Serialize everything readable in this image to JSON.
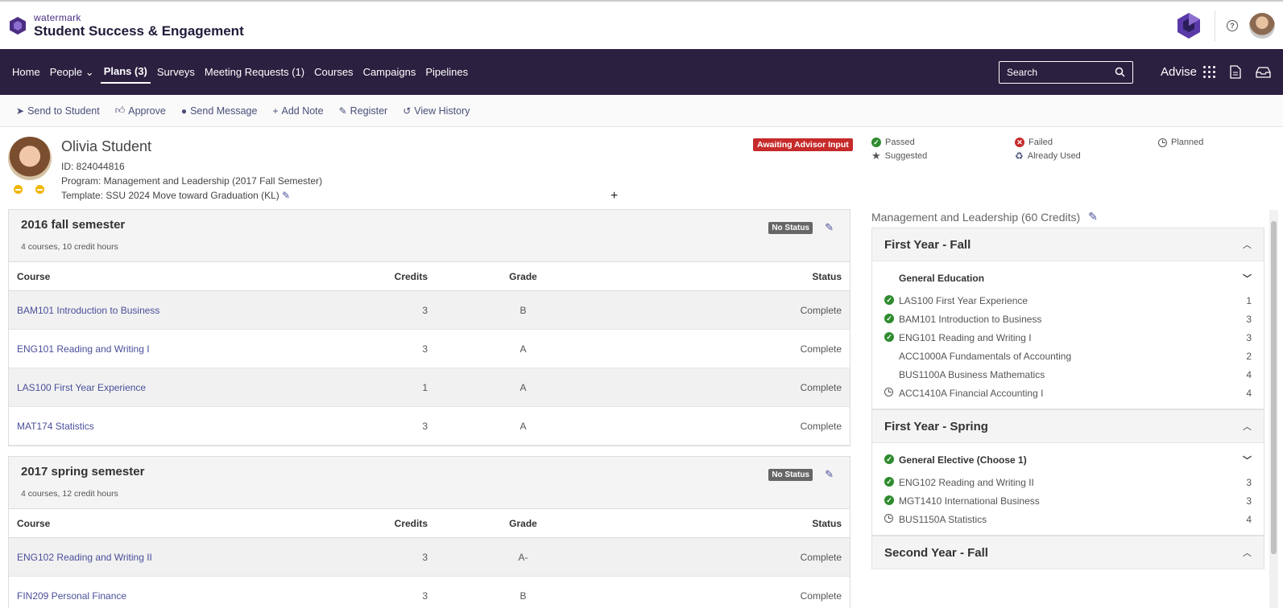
{
  "brand": {
    "small": "watermark",
    "title": "Student Success & Engagement"
  },
  "nav": {
    "items": [
      "Home",
      "People",
      "Plans (3)",
      "Surveys",
      "Meeting Requests (1)",
      "Courses",
      "Campaigns",
      "Pipelines"
    ],
    "search_label": "Search",
    "advise_label": "Advise"
  },
  "actions": [
    "Send to Student",
    "Approve",
    "Send Message",
    "Add Note",
    "Register",
    "View History"
  ],
  "student": {
    "name": "Olivia Student",
    "id_line": "ID: 824044816",
    "program_line": "Program: Management and Leadership (2017 Fall Semester)",
    "template_line": "Template: SSU 2024 Move toward Graduation (KL)",
    "plan_status": "Awaiting Advisor Input"
  },
  "legend": {
    "passed": "Passed",
    "failed": "Failed",
    "planned": "Planned",
    "suggested": "Suggested",
    "already_used": "Already Used"
  },
  "table_headers": {
    "course": "Course",
    "credits": "Credits",
    "grade": "Grade",
    "status": "Status"
  },
  "semesters": [
    {
      "title": "2016 fall semester",
      "summary": "4 courses, 10 credit hours",
      "status": "No Status",
      "rows": [
        {
          "course": "BAM101 Introduction to Business",
          "credits": "3",
          "grade": "B",
          "status": "Complete"
        },
        {
          "course": "ENG101 Reading and Writing I",
          "credits": "3",
          "grade": "A",
          "status": "Complete"
        },
        {
          "course": "LAS100 First Year Experience",
          "credits": "1",
          "grade": "A",
          "status": "Complete"
        },
        {
          "course": "MAT174 Statistics",
          "credits": "3",
          "grade": "A",
          "status": "Complete"
        }
      ]
    },
    {
      "title": "2017 spring semester",
      "summary": "4 courses, 12 credit hours",
      "status": "No Status",
      "rows": [
        {
          "course": "ENG102 Reading and Writing II",
          "credits": "3",
          "grade": "A-",
          "status": "Complete"
        },
        {
          "course": "FIN209 Personal Finance",
          "credits": "3",
          "grade": "B",
          "status": "Complete"
        }
      ]
    }
  ],
  "program": {
    "title": "Management and Leadership (60 Credits)",
    "years": [
      {
        "title": "First Year - Fall",
        "group": "General Education",
        "items": [
          {
            "name": "LAS100 First Year Experience",
            "credits": "1"
          },
          {
            "name": "BAM101 Introduction to Business",
            "credits": "3"
          },
          {
            "name": "ENG101 Reading and Writing I",
            "credits": "3"
          },
          {
            "name": "ACC1000A Fundamentals of Accounting",
            "credits": "2"
          },
          {
            "name": "BUS1100A Business Mathematics",
            "credits": "4"
          },
          {
            "name": "ACC1410A Financial Accounting I",
            "credits": "4"
          }
        ]
      },
      {
        "title": "First Year - Spring",
        "group": "General Elective (Choose 1)",
        "items": [
          {
            "name": "ENG102 Reading and Writing II",
            "credits": "3"
          },
          {
            "name": "MGT1410 International Business",
            "credits": "3"
          },
          {
            "name": "BUS1150A Statistics",
            "credits": "4"
          }
        ]
      },
      {
        "title": "Second Year - Fall"
      }
    ]
  }
}
